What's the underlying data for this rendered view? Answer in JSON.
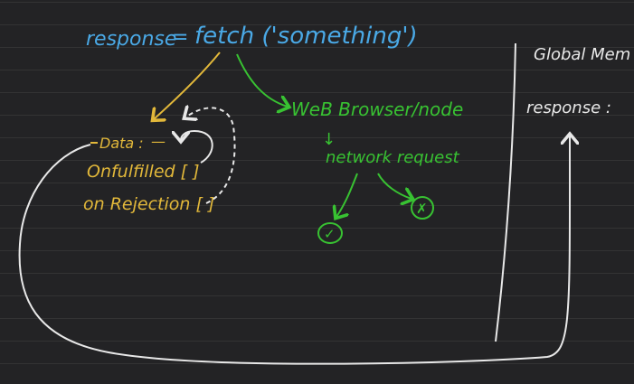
{
  "expression": {
    "left": "response",
    "equals": "=",
    "call": "fetch ('something')"
  },
  "promise_object": {
    "data_label": "Data :",
    "data_value": "—",
    "on_fulfilled": "Onfulfilled [ ]",
    "on_rejection": "on Rejection [ ]"
  },
  "runtime": {
    "label": "WeB Browser/node",
    "down_arrow": "↓",
    "request": "network request",
    "success_symbol": "✓",
    "failure_symbol": "✗"
  },
  "global_memory": {
    "title": "Global Mem",
    "entry": "response :"
  },
  "colors": {
    "background": "#232325",
    "expression": "#4aa9e6",
    "promise": "#e2b83a",
    "runtime": "#38c232",
    "memory": "#e8e8e8"
  }
}
